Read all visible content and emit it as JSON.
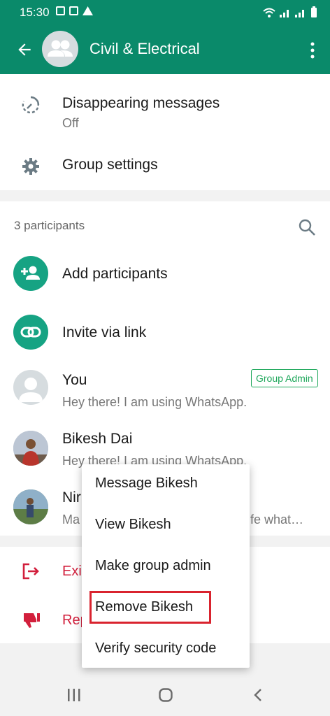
{
  "status_bar": {
    "time": "15:30"
  },
  "header": {
    "title": "Civil & Electrical"
  },
  "settings": {
    "disappearing_label": "Disappearing messages",
    "disappearing_value": "Off",
    "group_settings_label": "Group settings"
  },
  "participants": {
    "count_label": "3 participants",
    "add_label": "Add participants",
    "invite_label": "Invite via link",
    "members": [
      {
        "name": "You",
        "status": "Hey there! I am using WhatsApp.",
        "badge": "Group Admin"
      },
      {
        "name": "Bikesh Dai",
        "status": "Hey there! I am using WhatsApp."
      },
      {
        "name": "Nir",
        "status": "Ma",
        "status_tail": "fe what…"
      }
    ]
  },
  "actions": {
    "exit_label": "Exi",
    "report_label": "Rep"
  },
  "context_menu": {
    "items": [
      "Message Bikesh",
      "View Bikesh",
      "Make group admin",
      "Remove Bikesh",
      "Verify security code"
    ]
  },
  "colors": {
    "brand": "#0a8a6a",
    "accent": "#16a383",
    "danger": "#d21f3c",
    "highlight": "#d9232e"
  },
  "icons": [
    "back-arrow-icon",
    "group-avatar-icon",
    "more-vert-icon",
    "timer-icon",
    "gear-icon",
    "search-icon",
    "add-person-icon",
    "link-icon",
    "exit-icon",
    "thumb-down-icon"
  ]
}
